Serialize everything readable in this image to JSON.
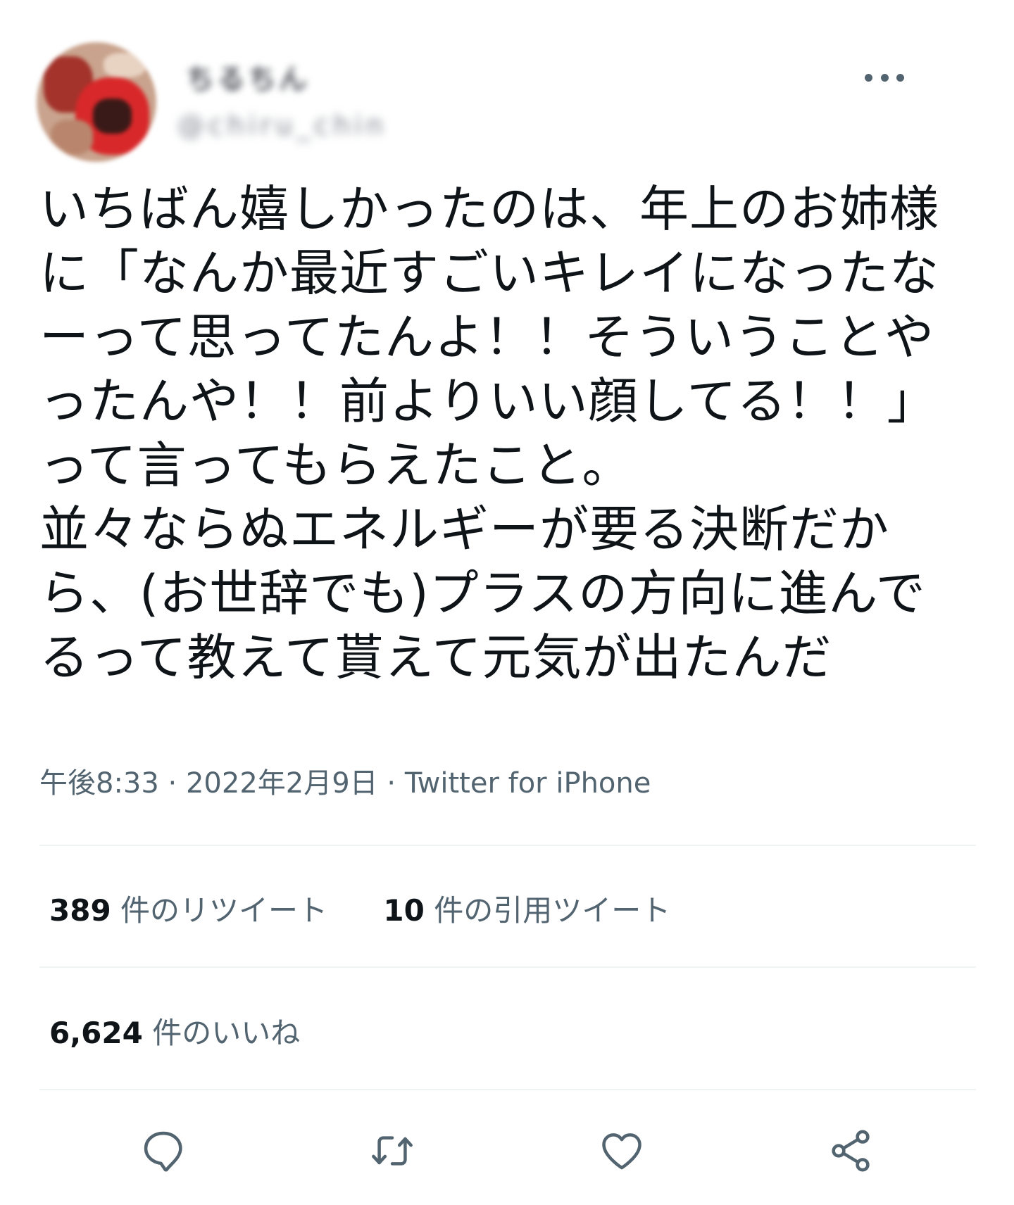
{
  "tweet": {
    "display_name": "ちるちん",
    "handle": "@chiru_chin",
    "text": "いちばん嬉しかったのは、年上のお姉様に「なんか最近すごいキレイになったなーって思ってたんよ！！そういうことやったんや！！前よりいい顔してる！！」って言ってもらえたこと。\n並々ならぬエネルギーが要る決断だから、(お世辞でも)プラスの方向に進んでるって教えて貰えて元気が出たんだ",
    "time": "午後8:33",
    "date": "2022年2月9日",
    "separator": "·",
    "source": "Twitter for iPhone"
  },
  "stats": {
    "retweets": {
      "count": "389",
      "label": "件のリツイート"
    },
    "quotes": {
      "count": "10",
      "label": "件の引用ツイート"
    },
    "likes": {
      "count": "6,624",
      "label": "件のいいね"
    }
  },
  "icons": {
    "more": "more-horizontal-icon",
    "reply": "reply-icon",
    "retweet": "retweet-icon",
    "like": "heart-icon",
    "share": "share-icon"
  },
  "colors": {
    "text_primary": "#0f1419",
    "text_secondary": "#536471",
    "divider": "#eff3f4"
  }
}
